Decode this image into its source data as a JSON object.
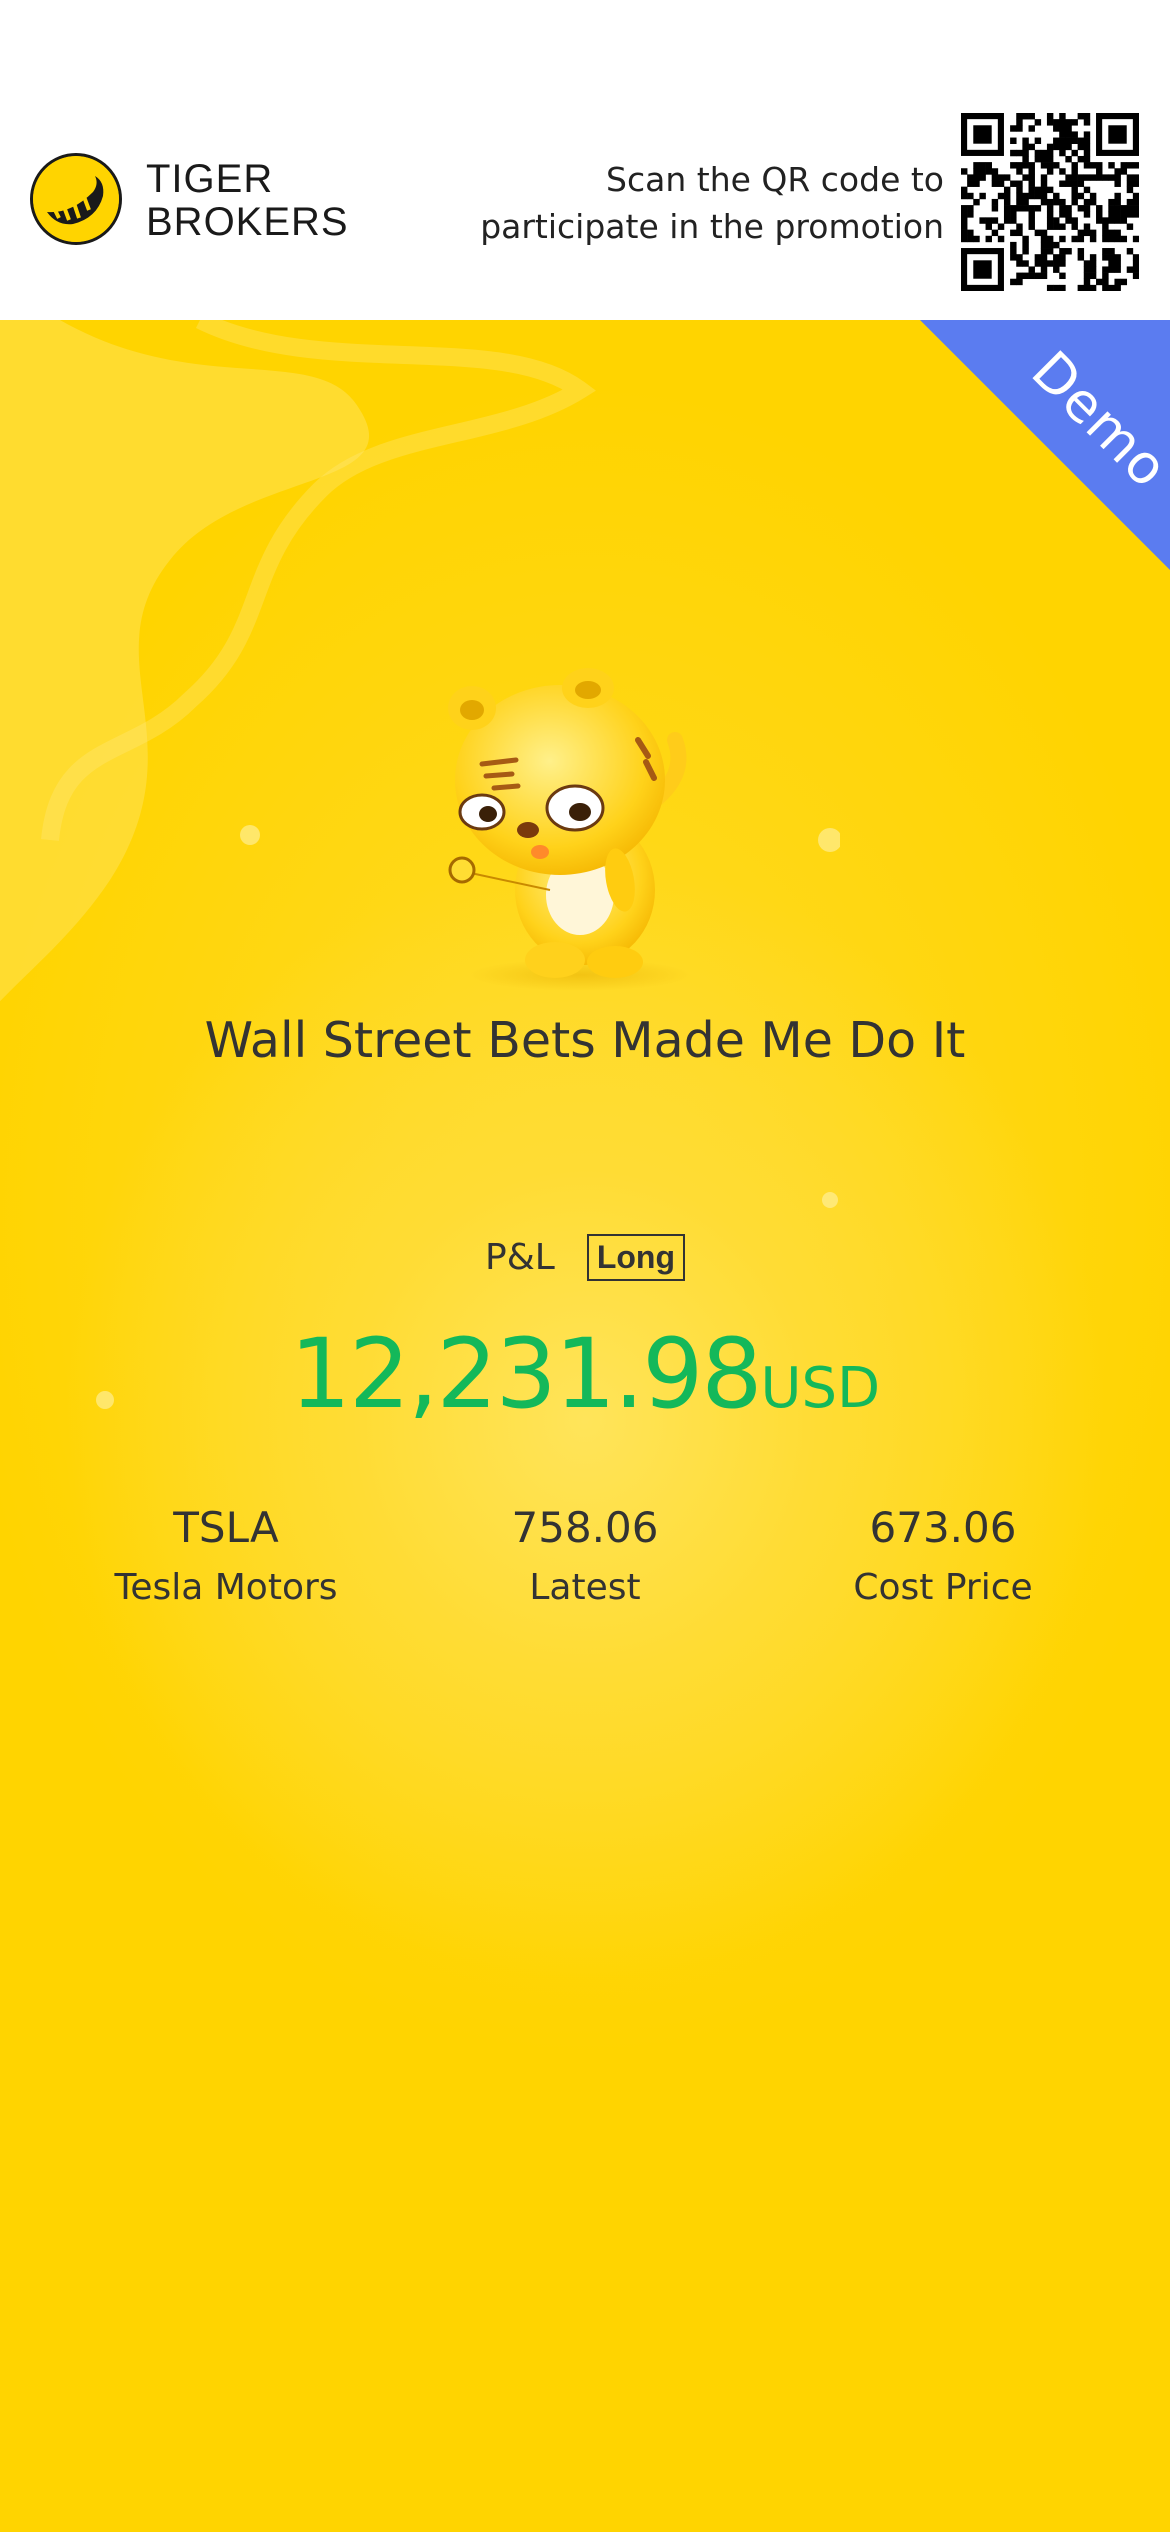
{
  "header": {
    "logo_line1": "TIGER",
    "logo_line2": "BROKERS",
    "scan_line1": "Scan the QR code to",
    "scan_line2": "participate in the promotion"
  },
  "ribbon": {
    "label": "Demo",
    "color": "#5b7cf0"
  },
  "headline": "Wall Street Bets Made Me Do It",
  "pnl": {
    "label": "P&L",
    "position": "Long",
    "amount": "12,231.98",
    "currency": "USD",
    "color": "#14b85a"
  },
  "stats": [
    {
      "value": "TSLA",
      "label": "Tesla Motors"
    },
    {
      "value": "758.06",
      "label": "Latest"
    },
    {
      "value": "673.06",
      "label": "Cost Price"
    }
  ],
  "colors": {
    "background": "#ffd400",
    "text": "#333333"
  }
}
